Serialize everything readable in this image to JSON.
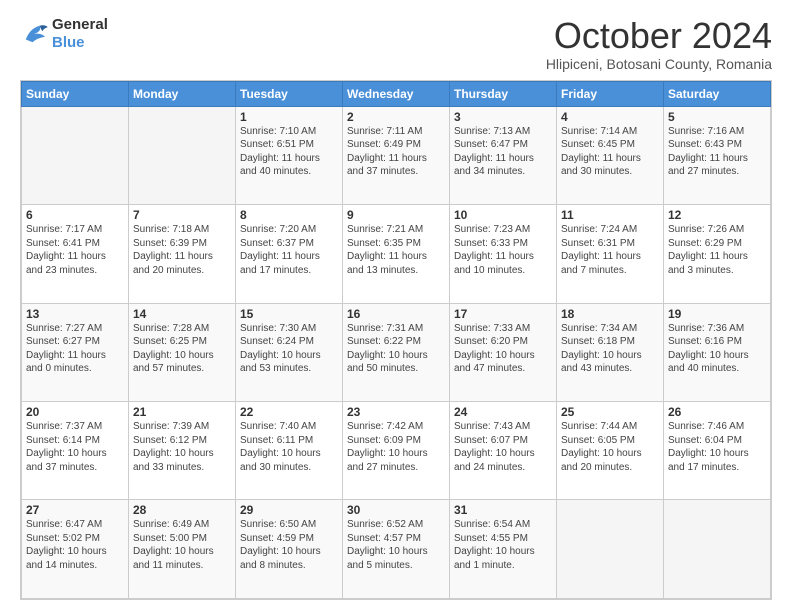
{
  "header": {
    "logo_general": "General",
    "logo_blue": "Blue",
    "month_title": "October 2024",
    "location": "Hlipiceni, Botosani County, Romania"
  },
  "days_of_week": [
    "Sunday",
    "Monday",
    "Tuesday",
    "Wednesday",
    "Thursday",
    "Friday",
    "Saturday"
  ],
  "weeks": [
    [
      {
        "day": "",
        "info": ""
      },
      {
        "day": "",
        "info": ""
      },
      {
        "day": "1",
        "info": "Sunrise: 7:10 AM\nSunset: 6:51 PM\nDaylight: 11 hours and 40 minutes."
      },
      {
        "day": "2",
        "info": "Sunrise: 7:11 AM\nSunset: 6:49 PM\nDaylight: 11 hours and 37 minutes."
      },
      {
        "day": "3",
        "info": "Sunrise: 7:13 AM\nSunset: 6:47 PM\nDaylight: 11 hours and 34 minutes."
      },
      {
        "day": "4",
        "info": "Sunrise: 7:14 AM\nSunset: 6:45 PM\nDaylight: 11 hours and 30 minutes."
      },
      {
        "day": "5",
        "info": "Sunrise: 7:16 AM\nSunset: 6:43 PM\nDaylight: 11 hours and 27 minutes."
      }
    ],
    [
      {
        "day": "6",
        "info": "Sunrise: 7:17 AM\nSunset: 6:41 PM\nDaylight: 11 hours and 23 minutes."
      },
      {
        "day": "7",
        "info": "Sunrise: 7:18 AM\nSunset: 6:39 PM\nDaylight: 11 hours and 20 minutes."
      },
      {
        "day": "8",
        "info": "Sunrise: 7:20 AM\nSunset: 6:37 PM\nDaylight: 11 hours and 17 minutes."
      },
      {
        "day": "9",
        "info": "Sunrise: 7:21 AM\nSunset: 6:35 PM\nDaylight: 11 hours and 13 minutes."
      },
      {
        "day": "10",
        "info": "Sunrise: 7:23 AM\nSunset: 6:33 PM\nDaylight: 11 hours and 10 minutes."
      },
      {
        "day": "11",
        "info": "Sunrise: 7:24 AM\nSunset: 6:31 PM\nDaylight: 11 hours and 7 minutes."
      },
      {
        "day": "12",
        "info": "Sunrise: 7:26 AM\nSunset: 6:29 PM\nDaylight: 11 hours and 3 minutes."
      }
    ],
    [
      {
        "day": "13",
        "info": "Sunrise: 7:27 AM\nSunset: 6:27 PM\nDaylight: 11 hours and 0 minutes."
      },
      {
        "day": "14",
        "info": "Sunrise: 7:28 AM\nSunset: 6:25 PM\nDaylight: 10 hours and 57 minutes."
      },
      {
        "day": "15",
        "info": "Sunrise: 7:30 AM\nSunset: 6:24 PM\nDaylight: 10 hours and 53 minutes."
      },
      {
        "day": "16",
        "info": "Sunrise: 7:31 AM\nSunset: 6:22 PM\nDaylight: 10 hours and 50 minutes."
      },
      {
        "day": "17",
        "info": "Sunrise: 7:33 AM\nSunset: 6:20 PM\nDaylight: 10 hours and 47 minutes."
      },
      {
        "day": "18",
        "info": "Sunrise: 7:34 AM\nSunset: 6:18 PM\nDaylight: 10 hours and 43 minutes."
      },
      {
        "day": "19",
        "info": "Sunrise: 7:36 AM\nSunset: 6:16 PM\nDaylight: 10 hours and 40 minutes."
      }
    ],
    [
      {
        "day": "20",
        "info": "Sunrise: 7:37 AM\nSunset: 6:14 PM\nDaylight: 10 hours and 37 minutes."
      },
      {
        "day": "21",
        "info": "Sunrise: 7:39 AM\nSunset: 6:12 PM\nDaylight: 10 hours and 33 minutes."
      },
      {
        "day": "22",
        "info": "Sunrise: 7:40 AM\nSunset: 6:11 PM\nDaylight: 10 hours and 30 minutes."
      },
      {
        "day": "23",
        "info": "Sunrise: 7:42 AM\nSunset: 6:09 PM\nDaylight: 10 hours and 27 minutes."
      },
      {
        "day": "24",
        "info": "Sunrise: 7:43 AM\nSunset: 6:07 PM\nDaylight: 10 hours and 24 minutes."
      },
      {
        "day": "25",
        "info": "Sunrise: 7:44 AM\nSunset: 6:05 PM\nDaylight: 10 hours and 20 minutes."
      },
      {
        "day": "26",
        "info": "Sunrise: 7:46 AM\nSunset: 6:04 PM\nDaylight: 10 hours and 17 minutes."
      }
    ],
    [
      {
        "day": "27",
        "info": "Sunrise: 6:47 AM\nSunset: 5:02 PM\nDaylight: 10 hours and 14 minutes."
      },
      {
        "day": "28",
        "info": "Sunrise: 6:49 AM\nSunset: 5:00 PM\nDaylight: 10 hours and 11 minutes."
      },
      {
        "day": "29",
        "info": "Sunrise: 6:50 AM\nSunset: 4:59 PM\nDaylight: 10 hours and 8 minutes."
      },
      {
        "day": "30",
        "info": "Sunrise: 6:52 AM\nSunset: 4:57 PM\nDaylight: 10 hours and 5 minutes."
      },
      {
        "day": "31",
        "info": "Sunrise: 6:54 AM\nSunset: 4:55 PM\nDaylight: 10 hours and 1 minute."
      },
      {
        "day": "",
        "info": ""
      },
      {
        "day": "",
        "info": ""
      }
    ]
  ]
}
